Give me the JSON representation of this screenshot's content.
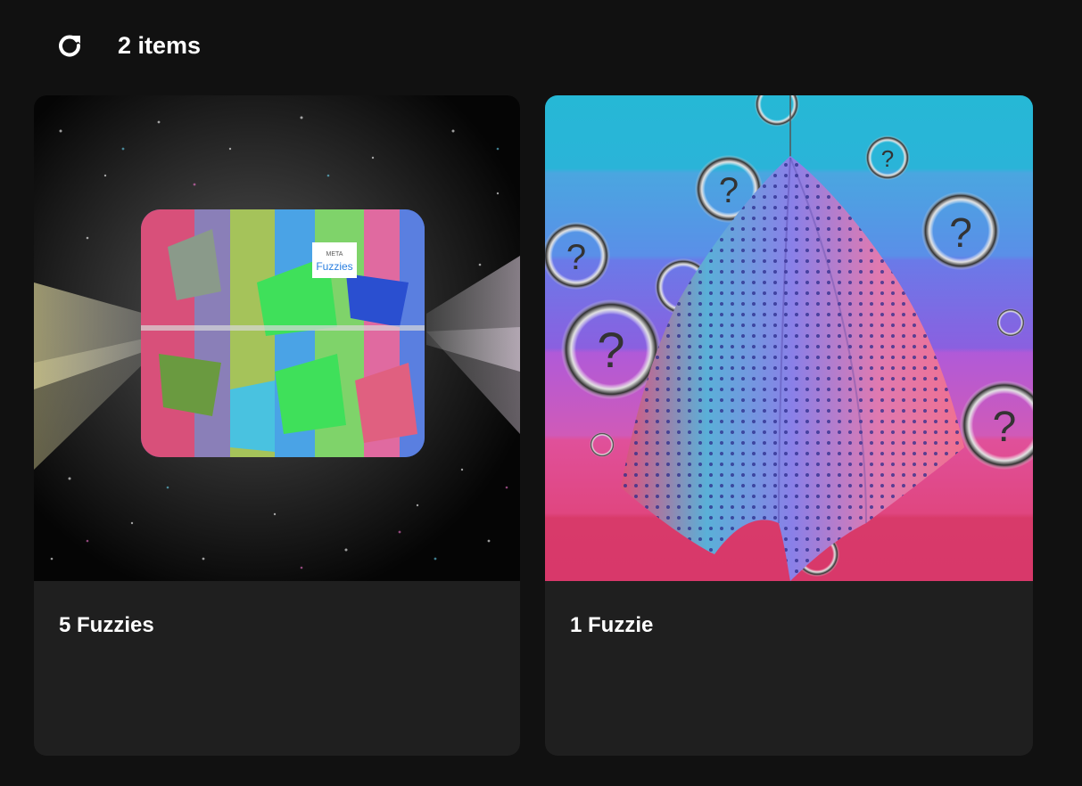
{
  "header": {
    "refresh_icon": "refresh-icon",
    "item_count": "2 items"
  },
  "cards": [
    {
      "title": "5 Fuzzies",
      "image": "fuzzy-cube-box-image",
      "box_label_top": "META",
      "box_label_main": "Fuzzies"
    },
    {
      "title": "1 Fuzzie",
      "image": "polka-dot-cloth-question-marks-image"
    }
  ],
  "colors": {
    "background": "#111111",
    "card": "#1f1f1f",
    "text": "#ffffff"
  }
}
